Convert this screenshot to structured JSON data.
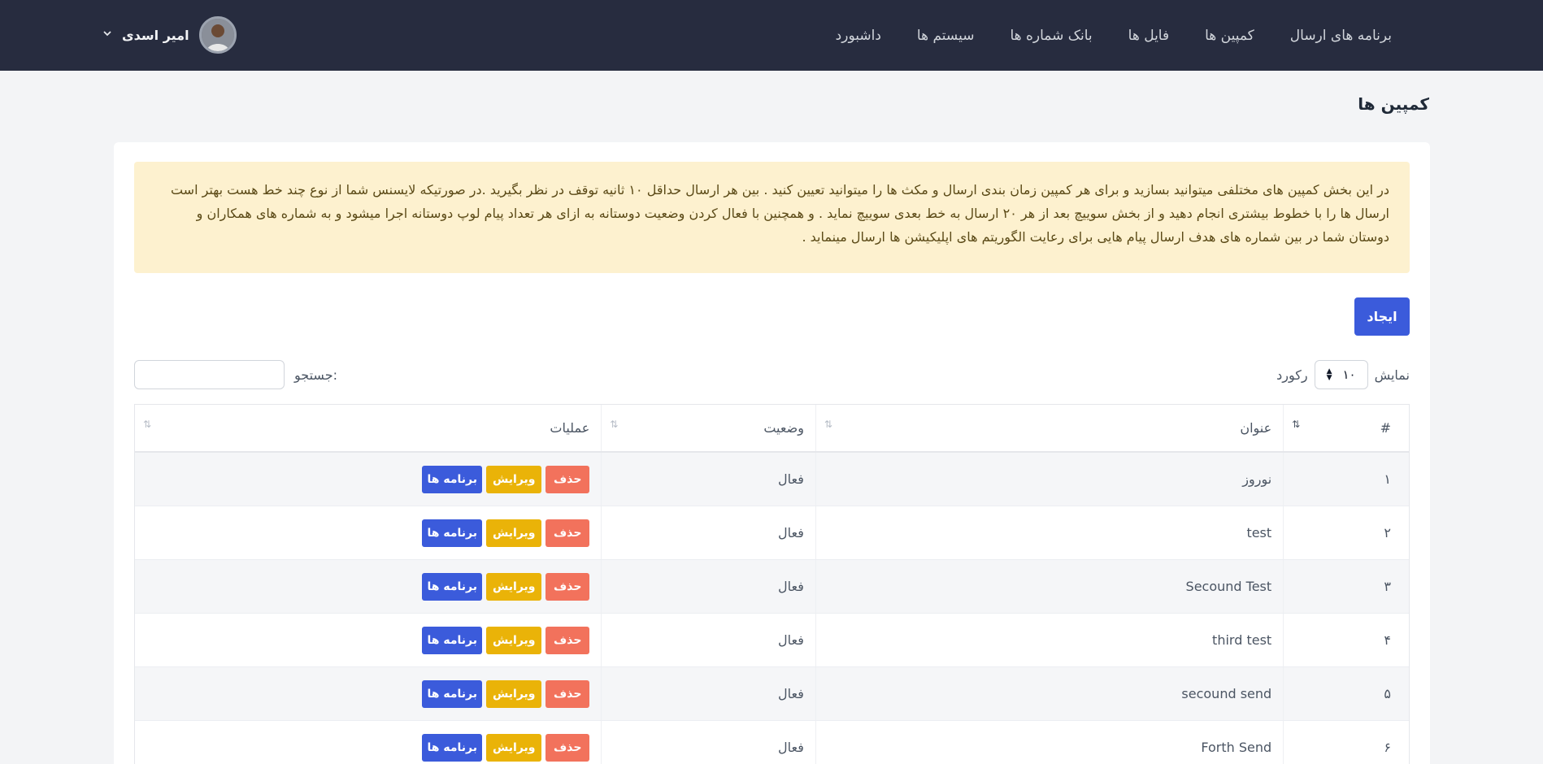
{
  "nav": {
    "items": [
      "داشبورد",
      "سیستم ها",
      "بانک شماره ها",
      "فایل ها",
      "کمپین ها",
      "برنامه های ارسال"
    ]
  },
  "user": {
    "name": "امیر اسدی",
    "chevron_icon": "chevron-down-icon"
  },
  "page": {
    "title": "کمپین ها"
  },
  "alert": {
    "text": "در این بخش کمپین های مختلفی میتوانید بسازید و برای هر کمپین زمان بندی ارسال و مکث ها را میتوانید تعیین کنید . بین هر ارسال حداقل ۱۰ ثانیه توقف در نظر بگیرید .در صورتیکه لایسنس شما از نوع چند خط هست بهتر است ارسال ها را با خطوط بیشتری انجام دهید و از بخش سوییچ بعد از هر ۲۰ ارسال به خط بعدی سوییچ نماید . و همچنین با فعال کردن وضعیت دوستانه به ازای هر تعداد پیام لوپ دوستانه اجرا میشود و به شماره های همکاران و دوستان شما در بین شماره های هدف ارسال پیام هایی برای رعایت الگوریتم های اپلیکیشن ها ارسال مینماید ."
  },
  "toolbar": {
    "create_label": "ایجاد",
    "show_label": "نمایش",
    "length_value": "۱۰",
    "records_label": "رکورد",
    "search_label": "جستجو:",
    "search_value": ""
  },
  "table": {
    "headers": {
      "num": "#",
      "title": "عنوان",
      "status": "وضعیت",
      "ops": "عملیات"
    },
    "buttons": {
      "delete": "حذف",
      "edit": "ویرایش",
      "programs": "برنامه ها"
    },
    "rows": [
      {
        "num": "۱",
        "title": "نوروز",
        "status": "فعال"
      },
      {
        "num": "۲",
        "title": "test",
        "status": "فعال"
      },
      {
        "num": "۳",
        "title": "Secound Test",
        "status": "فعال"
      },
      {
        "num": "۴",
        "title": "third test",
        "status": "فعال"
      },
      {
        "num": "۵",
        "title": "secound send",
        "status": "فعال"
      },
      {
        "num": "۶",
        "title": "Forth Send",
        "status": "فعال"
      }
    ]
  },
  "colors": {
    "navbar": "#272c3f",
    "primary": "#3b5bdb",
    "danger": "#f2725c",
    "warning": "#eab308",
    "alert_bg": "#fdf1cf"
  }
}
